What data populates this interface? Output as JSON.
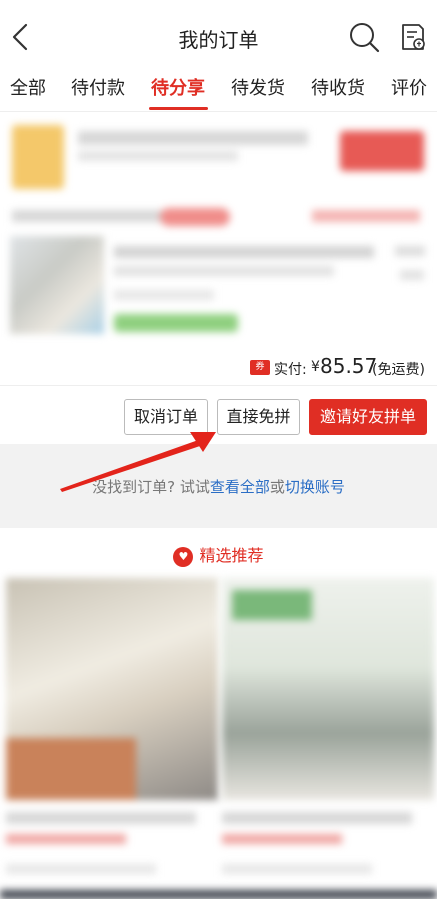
{
  "header": {
    "title": "我的订单",
    "back_icon": "chevron-left-icon",
    "search_icon": "search-icon",
    "bill_icon": "bill-icon"
  },
  "tabs": [
    {
      "label": "全部",
      "active": false
    },
    {
      "label": "待付款",
      "active": false
    },
    {
      "label": "待分享",
      "active": true
    },
    {
      "label": "待发货",
      "active": false
    },
    {
      "label": "待收货",
      "active": false
    },
    {
      "label": "评价",
      "active": false
    }
  ],
  "order": {
    "coupon_badge": "券",
    "paid_label": "实付:",
    "currency": "¥",
    "amount": "85.57",
    "shipping_note": "(免运费)",
    "buttons": {
      "cancel": "取消订单",
      "direct": "直接免拼",
      "invite": "邀请好友拼单"
    }
  },
  "empty_note": {
    "prefix": "没找到订单? 试试",
    "link_all": "查看全部",
    "or": "或",
    "link_switch": "切换账号"
  },
  "recommend": {
    "title": "精选推荐",
    "heart_icon": "heart-icon"
  },
  "colors": {
    "accent": "#e02e24",
    "link": "#2b6ec5"
  }
}
